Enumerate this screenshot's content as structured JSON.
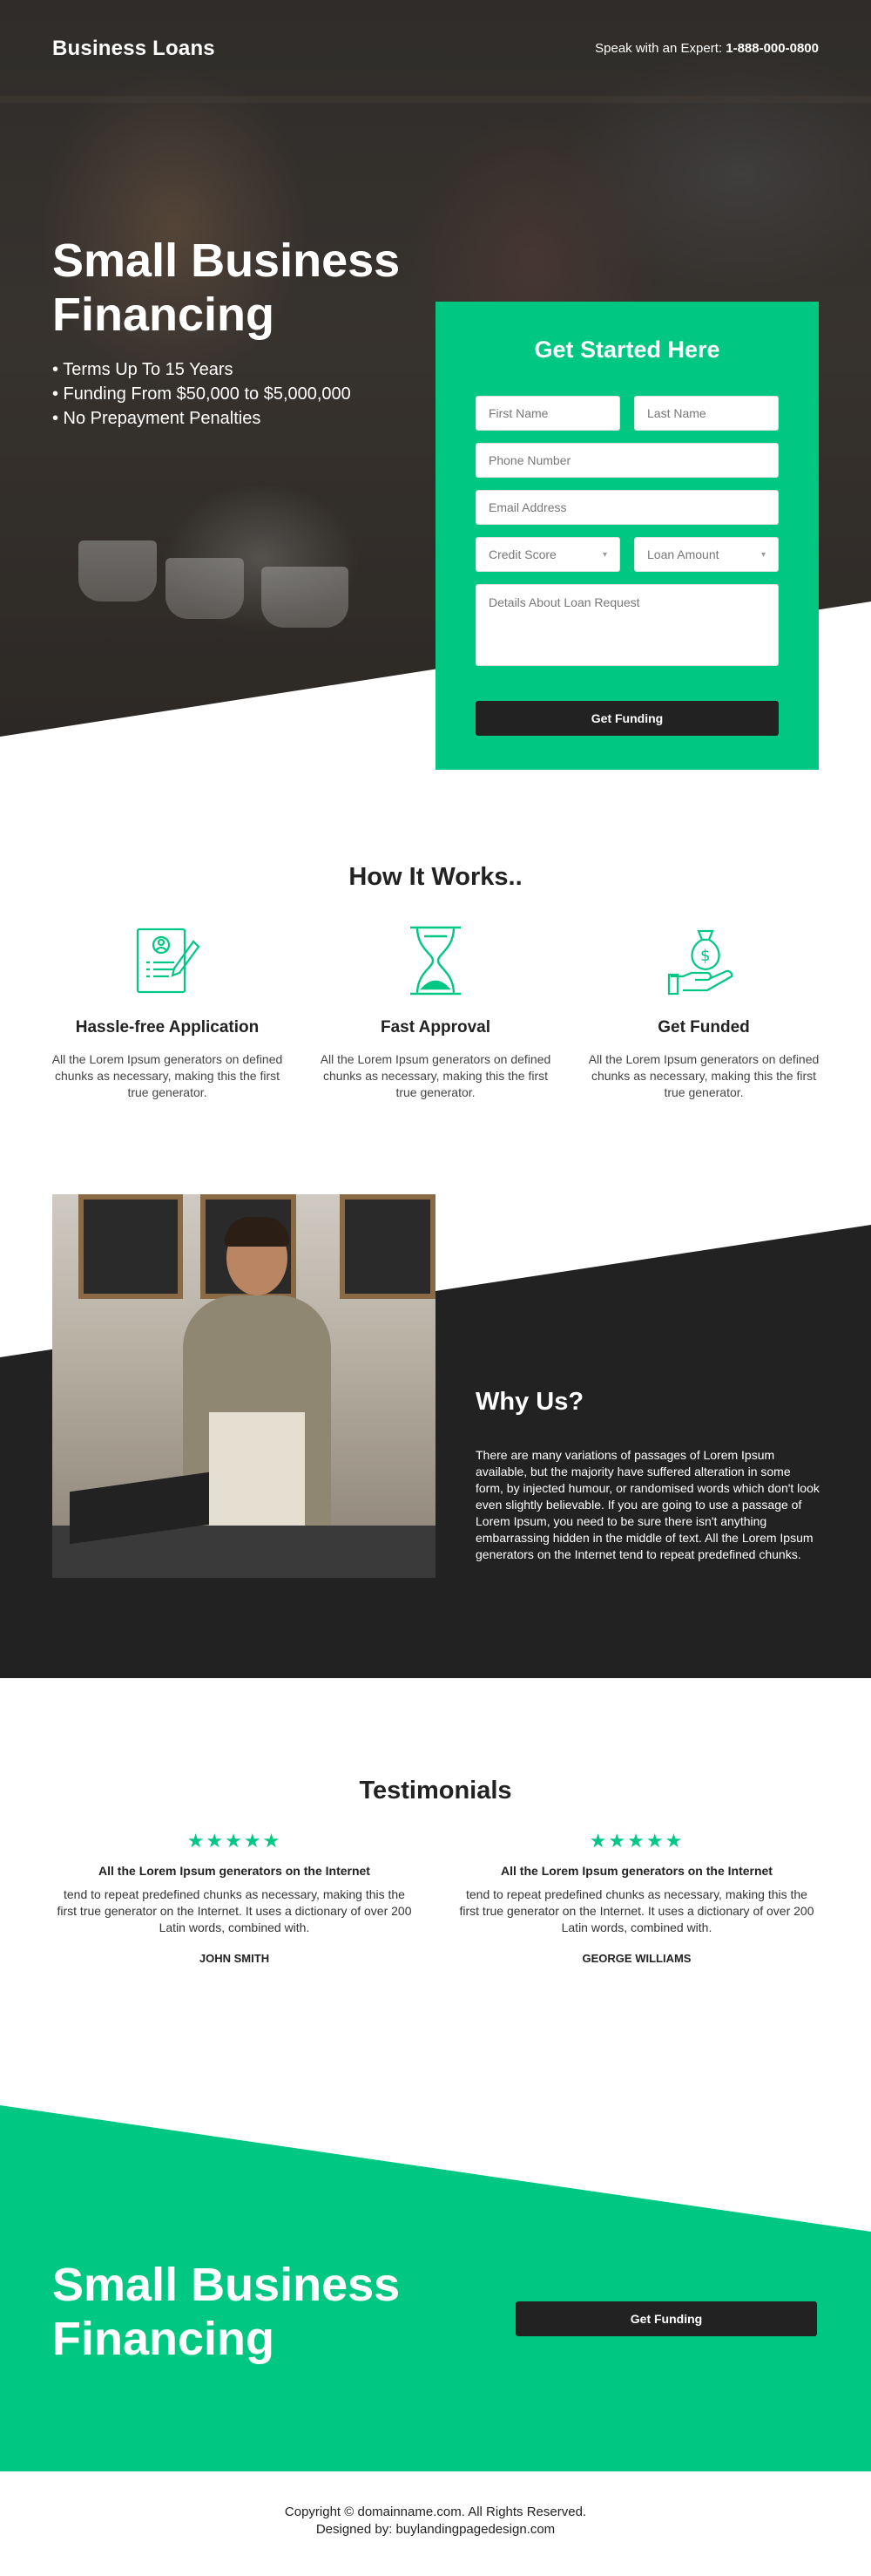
{
  "header": {
    "brand": "Business Loans",
    "expert_label": "Speak with an Expert: ",
    "expert_phone": "1-888-000-0800"
  },
  "hero": {
    "title": "Small Business Financing",
    "bullets": [
      "• Terms Up To 15 Years",
      "• Funding From $50,000 to $5,000,000",
      "• No Prepayment Penalties"
    ]
  },
  "form": {
    "title": "Get Started Here",
    "first_name_placeholder": "First Name",
    "last_name_placeholder": "Last Name",
    "phone_placeholder": "Phone Number",
    "email_placeholder": "Email Address",
    "credit_score_placeholder": "Credit Score",
    "loan_amount_placeholder": "Loan Amount",
    "details_placeholder": "Details About Loan Request",
    "submit_label": "Get Funding"
  },
  "how": {
    "title": "How It Works..",
    "steps": [
      {
        "title": "Hassle-free Application",
        "text": "All the Lorem Ipsum generators on defined chunks as necessary, making this the first true generator.",
        "icon": "application-form-icon"
      },
      {
        "title": "Fast Approval",
        "text": "All the Lorem Ipsum generators on defined chunks as necessary, making this the first true generator.",
        "icon": "hourglass-icon"
      },
      {
        "title": "Get Funded",
        "text": "All the Lorem Ipsum generators on defined chunks as necessary, making this the first true generator.",
        "icon": "money-bag-hand-icon"
      }
    ]
  },
  "why": {
    "title": "Why Us?",
    "text": "There are many variations of passages of Lorem Ipsum available, but the majority have suffered alteration in some form, by injected humour, or randomised words which don't look even slightly believable. If you are going to use a passage of Lorem Ipsum, you need to be sure there isn't anything embarrassing hidden in the middle of text. All the Lorem Ipsum generators on the Internet tend to repeat predefined chunks."
  },
  "testimonials": {
    "title": "Testimonials",
    "items": [
      {
        "stars": "★★★★★",
        "headline": "All the Lorem Ipsum generators on the Internet",
        "text": "tend to repeat predefined chunks as necessary, making this the first true generator on the Internet. It uses a dictionary of over 200 Latin words, combined with.",
        "name": "JOHN SMITH"
      },
      {
        "stars": "★★★★★",
        "headline": "All the Lorem Ipsum generators on the Internet",
        "text": "tend to repeat predefined chunks as necessary, making this the first true generator on the Internet. It uses a dictionary of over 200 Latin words, combined with.",
        "name": "GEORGE WILLIAMS"
      }
    ]
  },
  "cta": {
    "title": "Small Business Financing",
    "button_label": "Get Funding"
  },
  "footer": {
    "copyright": "Copyright © domainname.com. All Rights Reserved.",
    "designed_by": "Designed by: buylandingpagedesign.com"
  },
  "colors": {
    "accent": "#00c882",
    "dark": "#222222"
  }
}
